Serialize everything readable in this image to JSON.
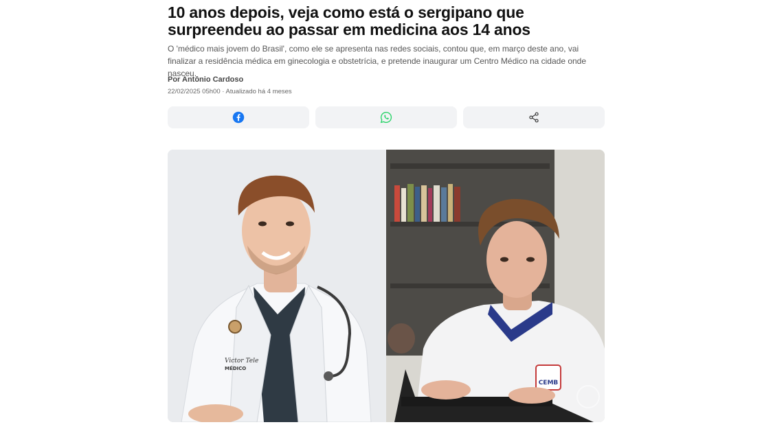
{
  "article": {
    "headline": "10 anos depois, veja como está o sergipano que surpreendeu ao passar em medicina aos 14 anos",
    "summary": "O 'médico mais jovem do Brasil', como ele se apresenta nas redes sociais, contou que, em março deste ano, vai finalizar a residência médica em ginecologia e obstetrícia, e pretende inaugurar um Centro Médico na cidade onde nasceu.",
    "byline_prefix": "Por",
    "author": "Antônio Cardoso",
    "date": "22/02/2025 05h00",
    "separator": "·",
    "updated": "Atualizado há 4 meses"
  },
  "share": {
    "buttons": [
      {
        "icon": "facebook-icon",
        "color": "#1877f2"
      },
      {
        "icon": "whatsapp-icon",
        "color": "#25d366"
      },
      {
        "icon": "share-icon",
        "color": "#333333"
      }
    ]
  },
  "photo": {
    "left_panel": "young-doctor-in-white-coat",
    "right_panel": "teenager-at-laptop",
    "coat_embroidery_name": "Victor Tele",
    "coat_embroidery_title": "MÉDICO",
    "shirt_logo": "CEMB"
  }
}
